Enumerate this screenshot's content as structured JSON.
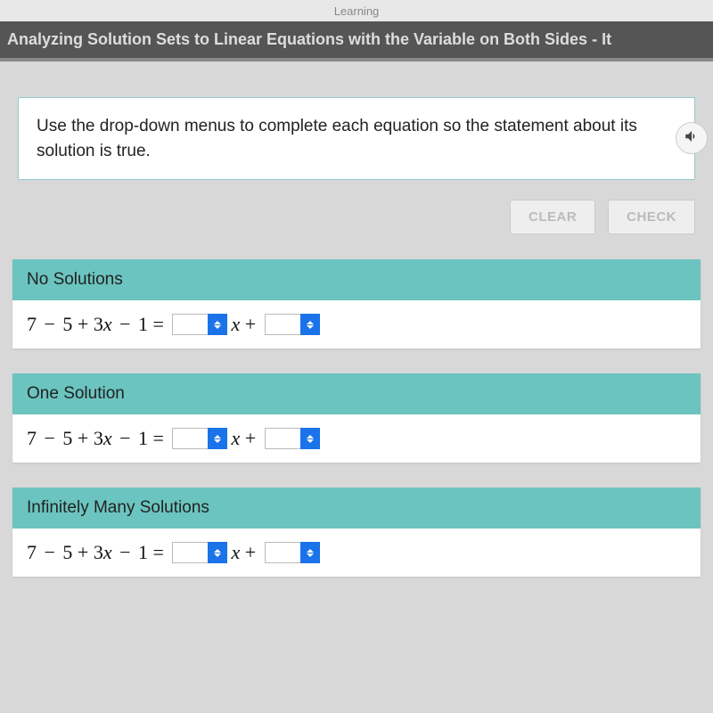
{
  "top_tab": "Learning",
  "header_title": "Analyzing Solution Sets to Linear Equations with the Variable on Both Sides - It",
  "directions": "Use the drop-down menus to complete each equation so the statement about its solution is true.",
  "buttons": {
    "clear": "CLEAR",
    "check": "CHECK"
  },
  "groups": [
    {
      "title": "No Solutions",
      "lhs": "7 − 5 + 3x − 1 =",
      "mid": "x +",
      "dd1": "",
      "dd2": ""
    },
    {
      "title": "One Solution",
      "lhs": "7 − 5 + 3x − 1 =",
      "mid": "x +",
      "dd1": "",
      "dd2": ""
    },
    {
      "title": "Infinitely Many Solutions",
      "lhs": "7 − 5 + 3x − 1 =",
      "mid": "x +",
      "dd1": "",
      "dd2": ""
    }
  ]
}
